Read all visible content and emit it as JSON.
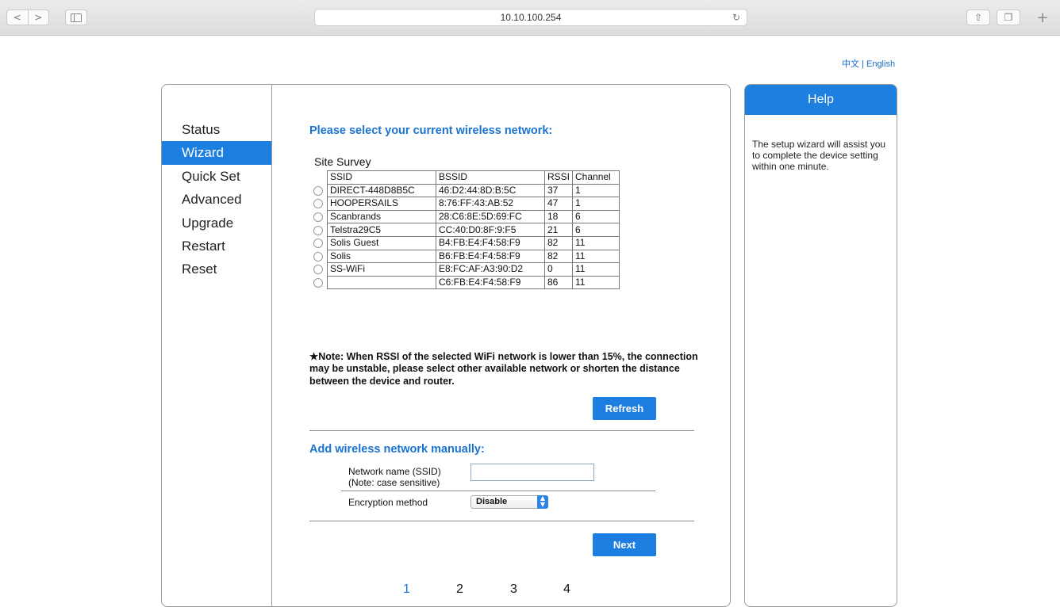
{
  "browser": {
    "url": "10.10.100.254",
    "back_glyph": "<",
    "forward_glyph": ">",
    "reload_glyph": "↻",
    "share_glyph": "⇧",
    "tabs_glyph": "❐",
    "new_tab_glyph": "+"
  },
  "language": {
    "chinese": "中文",
    "separator": "|",
    "english": "English"
  },
  "sidebar": {
    "items": [
      {
        "label": "Status"
      },
      {
        "label": "Wizard"
      },
      {
        "label": "Quick Set"
      },
      {
        "label": "Advanced"
      },
      {
        "label": "Upgrade"
      },
      {
        "label": "Restart"
      },
      {
        "label": "Reset"
      }
    ],
    "active": "Wizard"
  },
  "main": {
    "heading": "Please select your current wireless network:",
    "survey": {
      "title": "Site Survey",
      "columns": [
        "SSID",
        "BSSID",
        "RSSI",
        "Channel"
      ],
      "rows": [
        {
          "ssid": "DIRECT-448D8B5C",
          "bssid": "46:D2:44:8D:B:5C",
          "rssi": "37",
          "channel": "1"
        },
        {
          "ssid": "HOOPERSAILS",
          "bssid": "8:76:FF:43:AB:52",
          "rssi": "47",
          "channel": "1"
        },
        {
          "ssid": "Scanbrands",
          "bssid": "28:C6:8E:5D:69:FC",
          "rssi": "18",
          "channel": "6"
        },
        {
          "ssid": "Telstra29C5",
          "bssid": "CC:40:D0:8F:9:F5",
          "rssi": "21",
          "channel": "6"
        },
        {
          "ssid": "Solis Guest",
          "bssid": "B4:FB:E4:F4:58:F9",
          "rssi": "82",
          "channel": "11"
        },
        {
          "ssid": "Solis",
          "bssid": "B6:FB:E4:F4:58:F9",
          "rssi": "82",
          "channel": "11"
        },
        {
          "ssid": "SS-WiFi",
          "bssid": "E8:FC:AF:A3:90:D2",
          "rssi": "0",
          "channel": "11"
        },
        {
          "ssid": "",
          "bssid": "C6:FB:E4:F4:58:F9",
          "rssi": "86",
          "channel": "11"
        }
      ]
    },
    "note": "★Note: When RSSI of the selected WiFi network is lower than 15%, the connection may be unstable, please select other available network or shorten the distance between the device and router.",
    "refresh_label": "Refresh",
    "manual_heading": "Add wireless network manually:",
    "ssid_label_line1": "Network name (SSID)",
    "ssid_label_line2": "(Note: case sensitive)",
    "ssid_value": "",
    "encryption_label": "Encryption method",
    "encryption_value": "Disable",
    "next_label": "Next",
    "pages": [
      "1",
      "2",
      "3",
      "4"
    ]
  },
  "help": {
    "title": "Help",
    "text": "The setup wizard will assist you to complete the device setting within one minute."
  },
  "colors": {
    "accent": "#1d7fe0",
    "heading": "#1a73d1",
    "link": "#1a6ec6"
  }
}
